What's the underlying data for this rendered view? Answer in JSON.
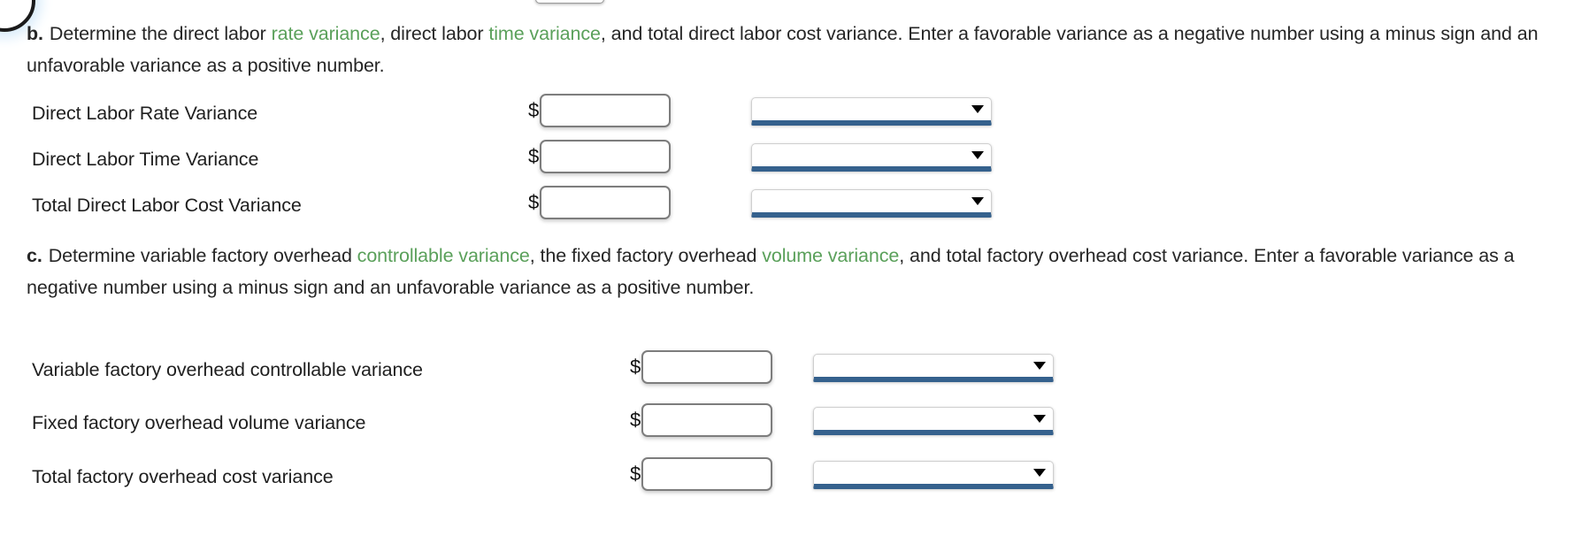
{
  "artifacts": {
    "clipped_circle_name": "clipped-circle-artifact",
    "clipped_field_name": "clipped-input-artifact"
  },
  "sections": [
    {
      "id": "b",
      "marker": "b.",
      "paragraph": {
        "segments": [
          {
            "text": "Determine the direct labor ",
            "style": "normal"
          },
          {
            "text": "rate variance",
            "style": "term"
          },
          {
            "text": ", direct labor ",
            "style": "normal"
          },
          {
            "text": "time variance",
            "style": "term"
          },
          {
            "text": ", and total direct labor cost variance. Enter a favorable variance as a negative number using a minus sign and an unfavorable variance as a positive number.",
            "style": "normal"
          }
        ]
      },
      "rows": [
        {
          "label": "Direct Labor Rate Variance",
          "currency": "$",
          "amount": "",
          "placeholder": "",
          "select_value": ""
        },
        {
          "label": "Direct Labor Time Variance",
          "currency": "$",
          "amount": "",
          "placeholder": "",
          "select_value": ""
        },
        {
          "label": "Total Direct Labor Cost Variance",
          "currency": "$",
          "amount": "",
          "placeholder": "",
          "select_value": ""
        }
      ]
    },
    {
      "id": "c",
      "marker": "c.",
      "paragraph": {
        "segments": [
          {
            "text": "Determine variable factory overhead ",
            "style": "normal"
          },
          {
            "text": "controllable variance",
            "style": "term"
          },
          {
            "text": ", the fixed factory overhead ",
            "style": "normal"
          },
          {
            "text": "volume variance",
            "style": "term"
          },
          {
            "text": ", and total factory overhead cost variance. Enter a favorable variance as a negative number using a minus sign and an unfavorable variance as a positive number.",
            "style": "normal"
          }
        ]
      },
      "rows": [
        {
          "label": "Variable factory overhead controllable variance",
          "currency": "$",
          "amount": "",
          "placeholder": "",
          "select_value": ""
        },
        {
          "label": "Fixed factory overhead volume variance",
          "currency": "$",
          "amount": "",
          "placeholder": "",
          "select_value": ""
        },
        {
          "label": "Total factory overhead cost variance",
          "currency": "$",
          "amount": "",
          "placeholder": "",
          "select_value": ""
        }
      ]
    }
  ],
  "icons": {
    "dropdown_caret": "chevron-down-icon"
  },
  "colors": {
    "term_green": "#5aa05a",
    "select_underline_blue": "#35618d",
    "input_border_gray": "#7d7d7d",
    "text": "#262626"
  }
}
